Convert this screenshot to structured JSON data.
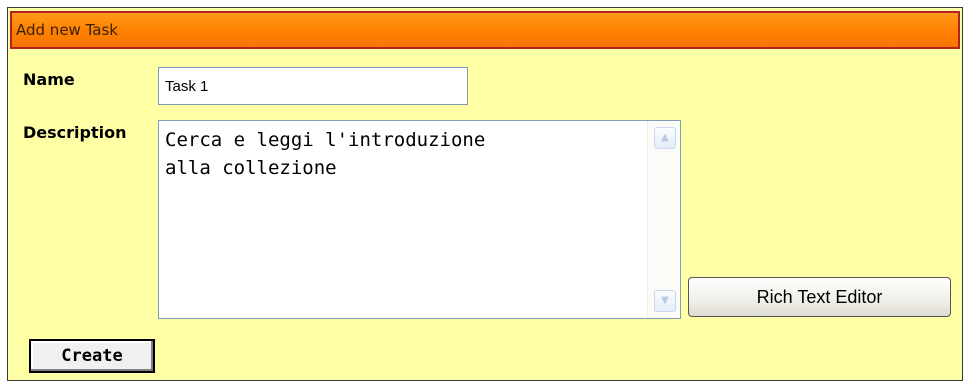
{
  "panel": {
    "title": "Add new Task",
    "title_color": "#ff8000",
    "background_color": "#ffffa6"
  },
  "form": {
    "name_label": "Name",
    "name_value": "Task 1",
    "description_label": "Description",
    "description_value": "Cerca e leggi l'introduzione\nalla collezione"
  },
  "scrollbar": {
    "up_icon": "triangle-up-icon",
    "down_icon": "triangle-down-icon"
  },
  "buttons": {
    "rich_text_editor_label": "Rich Text Editor",
    "create_label": "Create"
  }
}
